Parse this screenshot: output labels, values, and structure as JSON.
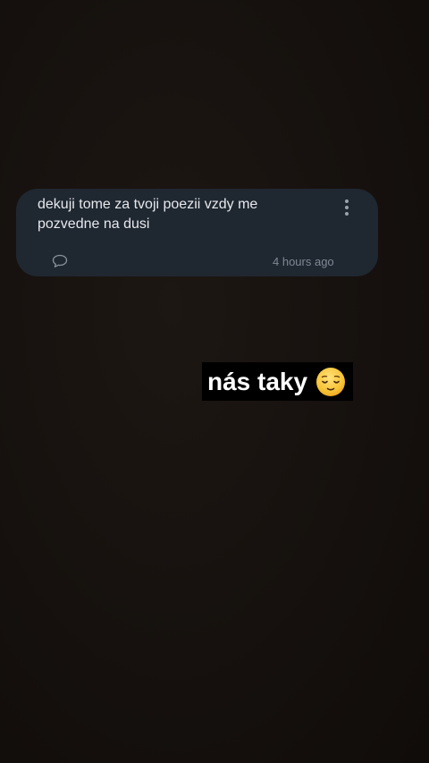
{
  "comment": {
    "text": "dekuji tome za tvoji poezii vzdy me pozvedne na dusi",
    "timestamp": "4 hours ago",
    "icons": {
      "reply": "speech-bubble-icon",
      "more": "more-vertical-icon"
    }
  },
  "sticker": {
    "text": "nás taky",
    "emoji": "relieved-face-emoji"
  },
  "colors": {
    "background": "#17120f",
    "card": "#1f2731",
    "comment_text": "#e7e9ec",
    "timestamp": "#7f8893",
    "sticker_bg": "#000000",
    "sticker_text": "#ffffff",
    "emoji": "#f7c234"
  }
}
